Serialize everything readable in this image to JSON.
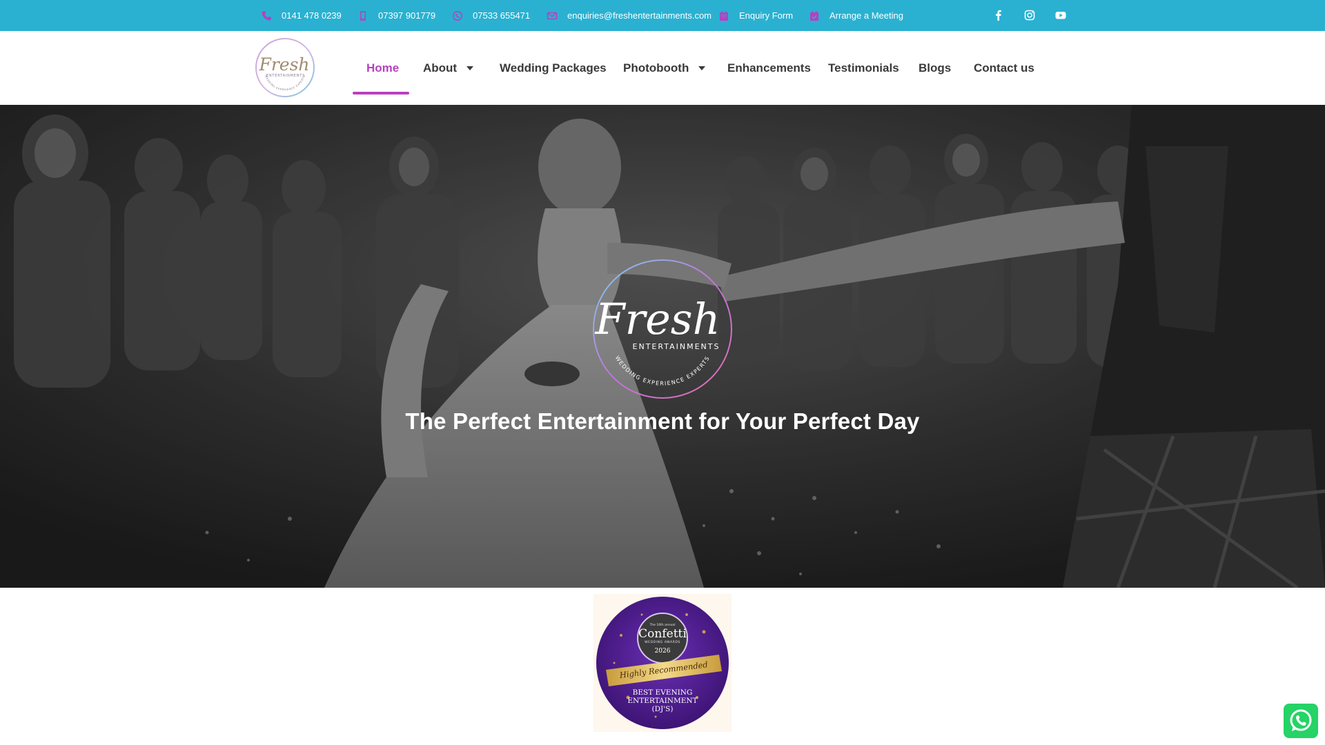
{
  "topbar": {
    "background": "#2ab1d1",
    "icon_color": "#b83fc0",
    "items": [
      {
        "icon": "phone-icon",
        "label": "0141 478 0239"
      },
      {
        "icon": "mobile-icon",
        "label": "07397 901779"
      },
      {
        "icon": "whatsapp-icon",
        "label": "07533 655471"
      },
      {
        "icon": "mail-icon",
        "label": "enquiries@freshentertainments.com"
      },
      {
        "icon": "calendar-icon",
        "label": "Enquiry Form"
      },
      {
        "icon": "calendar-check-icon",
        "label": "Arrange a Meeting"
      }
    ],
    "social": [
      "facebook-icon",
      "instagram-icon",
      "youtube-icon"
    ]
  },
  "header": {
    "logo_text": "Fresh",
    "logo_subtext": "ENTERTAINMENTS",
    "logo_tagline": "WEDDING EXPERIENCE EXPERTS",
    "accent": "#b83fc0",
    "nav": [
      {
        "label": "Home",
        "active": true,
        "has_dropdown": false
      },
      {
        "label": "About",
        "active": false,
        "has_dropdown": true
      },
      {
        "label": "Wedding Packages",
        "active": false,
        "has_dropdown": false
      },
      {
        "label": "Photobooth",
        "active": false,
        "has_dropdown": true
      },
      {
        "label": "Enhancements",
        "active": false,
        "has_dropdown": false
      },
      {
        "label": "Testimonials",
        "active": false,
        "has_dropdown": false
      },
      {
        "label": "Blogs",
        "active": false,
        "has_dropdown": false
      },
      {
        "label": "Contact us",
        "active": false,
        "has_dropdown": false
      }
    ]
  },
  "hero": {
    "logo_text": "Fresh",
    "logo_subtext": "ENTERTAINMENTS",
    "logo_tagline": "WEDDING EXPERIENCE EXPERTS",
    "title": "The Perfect Entertainment for Your Perfect Day"
  },
  "award": {
    "small_text": "The 16th annual",
    "brand": "Confetti",
    "brand_sub": "WEDDING AWARDS",
    "year": "2026",
    "ribbon": "Highly Recommended",
    "category_line1": "BEST EVENING",
    "category_line2": "ENTERTAINMENT",
    "category_line3": "(DJ'S)"
  },
  "whatsapp": {
    "icon": "whatsapp-icon"
  }
}
